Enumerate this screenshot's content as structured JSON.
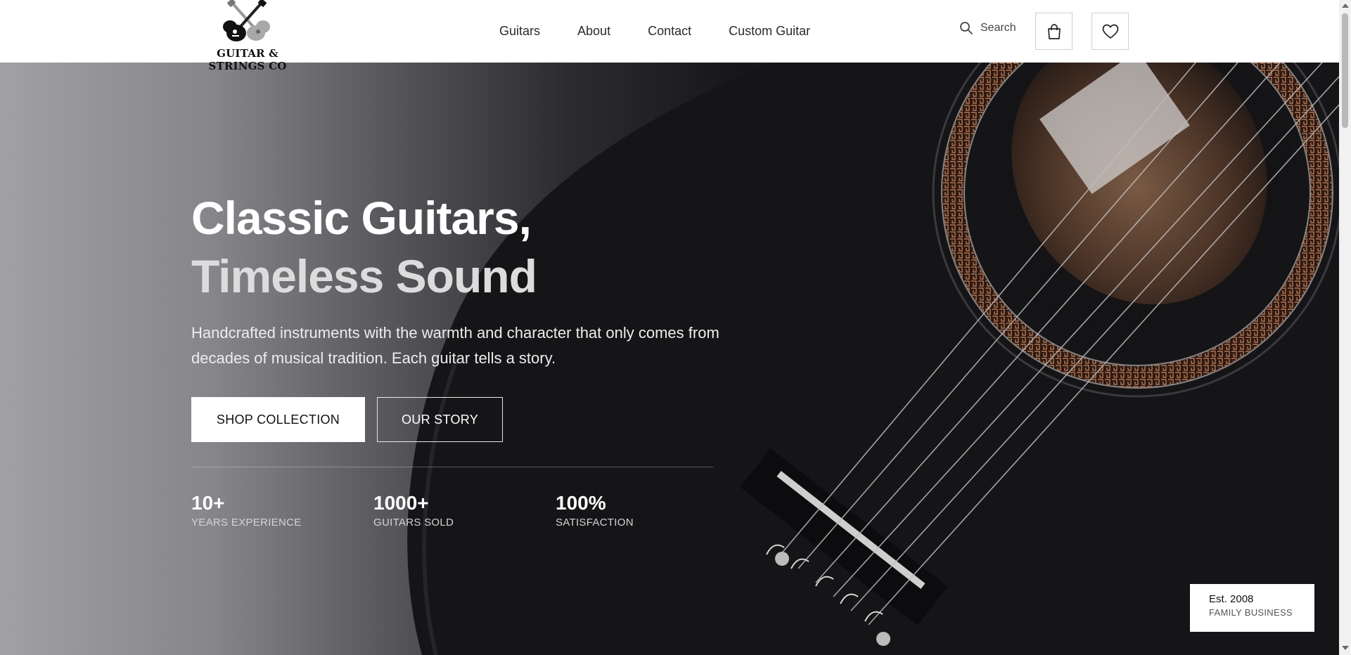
{
  "brand": {
    "logo_text": "GUITAR & STRINGS CO"
  },
  "nav": {
    "items": [
      "Guitars",
      "About",
      "Contact",
      "Custom Guitar"
    ]
  },
  "header_actions": {
    "search_label": "Search"
  },
  "hero": {
    "title_line1": "Classic Guitars,",
    "title_line2": "Timeless Sound",
    "subtitle": "Handcrafted instruments with the warmth and character that only comes from decades of musical tradition. Each guitar tells a story.",
    "primary_button": "SHOP COLLECTION",
    "secondary_button": "OUR STORY",
    "stats": [
      {
        "value": "10+",
        "label": "YEARS EXPERIENCE"
      },
      {
        "value": "1000+",
        "label": "GUITARS SOLD"
      },
      {
        "value": "100%",
        "label": "SATISFACTION"
      }
    ],
    "badge": {
      "line1": "Est. 2008",
      "line2": "FAMILY BUSINESS"
    }
  },
  "icons": {
    "search": "search-icon",
    "cart": "shopping-bag-icon",
    "wishlist": "heart-icon",
    "logo": "crossed-guitars-icon"
  }
}
